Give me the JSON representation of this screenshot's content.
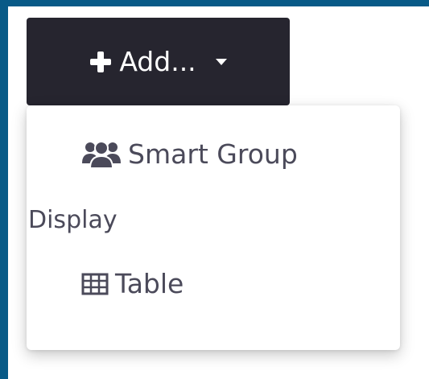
{
  "add_button": {
    "label": "Add...",
    "icon": "plus-icon",
    "caret_icon": "caret-down-icon"
  },
  "menu": {
    "items": [
      {
        "label": "Smart Group",
        "icon": "users-group-icon"
      }
    ],
    "sections": [
      {
        "header": "Display",
        "items": [
          {
            "label": "Table",
            "icon": "table-icon"
          }
        ]
      }
    ]
  },
  "colors": {
    "frame_edge": "#085a87",
    "button_bg": "#26252f",
    "menu_text": "#4b4a5a"
  }
}
